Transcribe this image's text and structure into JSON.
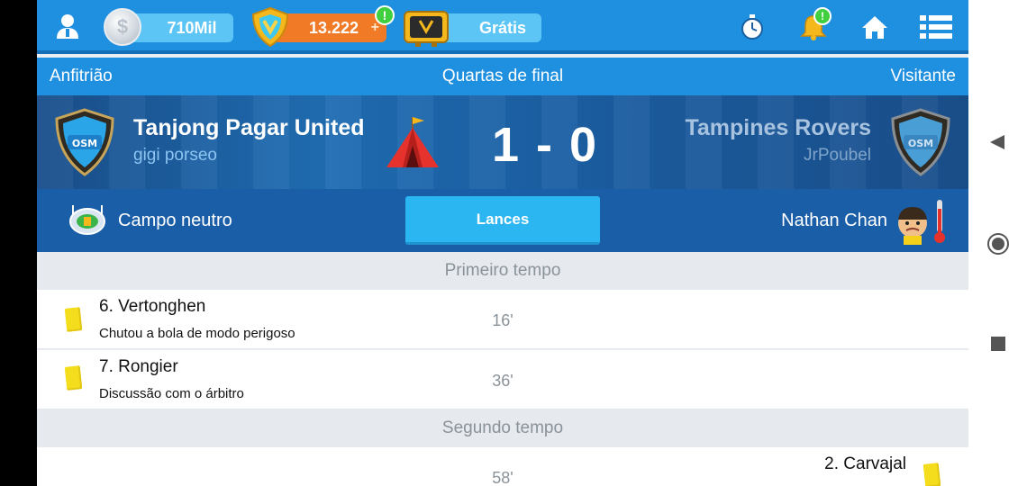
{
  "topbar": {
    "money": "710Mil",
    "coins": "13.222",
    "coins_plus": "+",
    "coins_alert": "!",
    "free_label": "Grátis",
    "notif_alert": "!"
  },
  "match": {
    "home_label": "Anfitrião",
    "round": "Quartas de final",
    "away_label": "Visitante",
    "home_team": "Tanjong Pagar United",
    "home_manager": "gigi porseo",
    "away_team": "Tampines Rovers",
    "away_manager": "JrPoubel",
    "score": "1 - 0",
    "badge_text": "OSM",
    "venue": "Campo neutro",
    "events_button": "Lances",
    "referee": "Nathan Chan"
  },
  "events": {
    "first_half": "Primeiro tempo",
    "second_half": "Segundo tempo",
    "items": [
      {
        "player": "6. Vertonghen",
        "reason": "Chutou a bola de modo perigoso",
        "minute": "16'"
      },
      {
        "player": "7. Rongier",
        "reason": "Discussão com o árbitro",
        "minute": "36'"
      },
      {
        "player": "2. Carvajal",
        "reason": "",
        "minute": "58'"
      }
    ]
  },
  "colors": {
    "accent": "#1f8fe0",
    "button": "#2bb6f2",
    "yellow_card": "#f4dd1d"
  }
}
